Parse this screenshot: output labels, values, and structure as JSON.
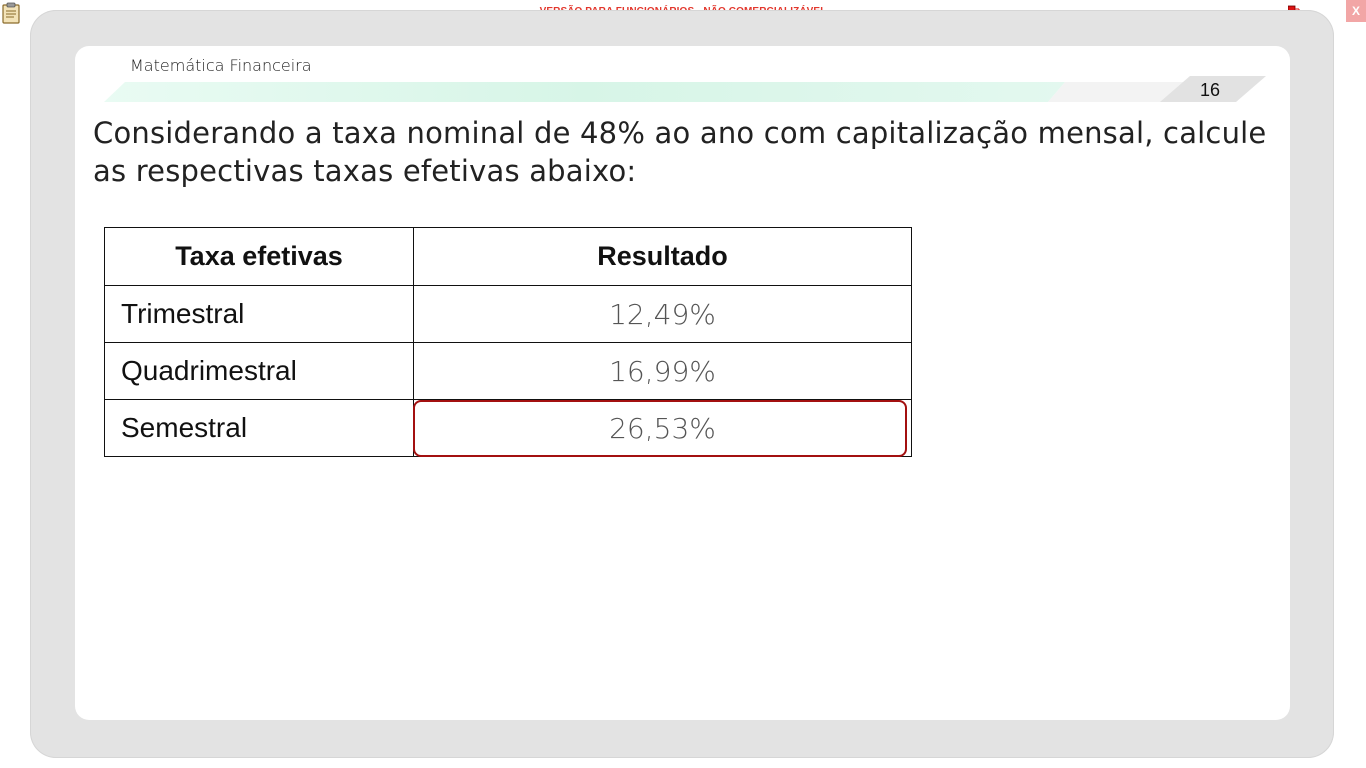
{
  "window": {
    "watermark": "VERSÃO PARA FUNCIONÁRIOS - NÃO COMERCIALIZÁVEL",
    "close_label": "X",
    "left_icon": "clipboard-icon",
    "tray_icon": "network-status-icon"
  },
  "slide": {
    "course_title": "Matemática Financeira",
    "page_number": "16",
    "question": "Considerando a taxa nominal de 48% ao ano com capitalização mensal, calcule as respectivas taxas efetivas abaixo:",
    "table": {
      "headers": [
        "Taxa efetivas",
        "Resultado"
      ],
      "rows": [
        {
          "label": "Trimestral",
          "value": "12,49%"
        },
        {
          "label": "Quadrimestral",
          "value": "16,99%"
        },
        {
          "label": "Semestral",
          "value": "26,53%"
        }
      ],
      "highlighted_row": "Semestral"
    }
  },
  "colors": {
    "watermark": "#e2372d",
    "highlight_border": "#a31010",
    "ribbon": "#dff8ee",
    "frame": "#e3e3e3"
  }
}
